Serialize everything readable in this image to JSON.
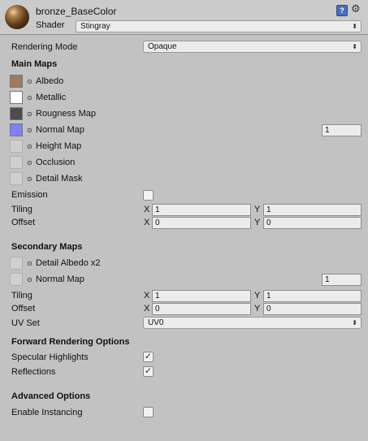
{
  "header": {
    "material_name": "bronze_BaseColor",
    "shader_label": "Shader",
    "shader_value": "Stingray",
    "help_icon": "?",
    "settings_icon": "gear-icon"
  },
  "rendering_mode": {
    "label": "Rendering Mode",
    "value": "Opaque"
  },
  "main_maps": {
    "title": "Main Maps",
    "albedo": {
      "label": "Albedo",
      "color": "#a07a5c"
    },
    "metallic": {
      "label": "Metallic",
      "color": "#ffffff"
    },
    "roughness": {
      "label": "Rougness Map",
      "color": "#4c4c4c"
    },
    "normal": {
      "label": "Normal Map",
      "color": "#8080ff",
      "value": "1"
    },
    "height": {
      "label": "Height Map"
    },
    "occlusion": {
      "label": "Occlusion"
    },
    "detail_mask": {
      "label": "Detail Mask"
    },
    "emission_label": "Emission",
    "tiling_label": "Tiling",
    "tiling_x": "1",
    "tiling_y": "1",
    "offset_label": "Offset",
    "offset_x": "0",
    "offset_y": "0"
  },
  "secondary_maps": {
    "title": "Secondary Maps",
    "detail_albedo_label": "Detail Albedo x2",
    "normal_label": "Normal Map",
    "normal_value": "1",
    "tiling_label": "Tiling",
    "tiling_x": "1",
    "tiling_y": "1",
    "offset_label": "Offset",
    "offset_x": "0",
    "offset_y": "0",
    "uv_set_label": "UV Set",
    "uv_set_value": "UV0"
  },
  "forward_rendering": {
    "title": "Forward Rendering Options",
    "specular_label": "Specular Highlights",
    "specular_checked": true,
    "reflections_label": "Reflections",
    "reflections_checked": true
  },
  "advanced": {
    "title": "Advanced Options",
    "instancing_label": "Enable Instancing",
    "instancing_checked": false
  },
  "axis_labels": {
    "x": "X",
    "y": "Y"
  },
  "glyphs": {
    "check": "✓",
    "arrow": "⬍",
    "dot": "⊙"
  }
}
